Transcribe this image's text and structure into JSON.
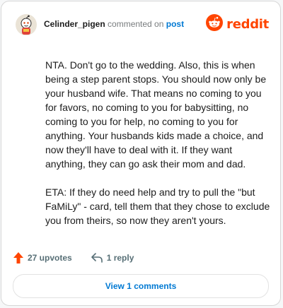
{
  "header": {
    "username": "Celinder_pigen",
    "action_text": "commented on",
    "post_link": "post",
    "brand_name": "reddit",
    "avatar_icon": "snoo-avatar-icon",
    "brand_icon": "reddit-logo-icon"
  },
  "comment": {
    "paragraphs": [
      "NTA. Don't go to the wedding. Also, this is when being a step parent stops. You should now only be your husband wife. That means no coming to you for favors, no coming to you for babysitting, no coming to you for help, no coming to you for anything. Your husbands kids made a choice, and now they'll have to deal with it. If they want anything, they can go ask their mom and dad.",
      "ETA: If they do need help and try to pull the \"but FaMiLy\" - card, tell them that they chose to exclude you from theirs, so now they aren't yours."
    ]
  },
  "actions": {
    "upvotes_label": "27 upvotes",
    "reply_label": "1 reply",
    "upvote_icon": "upvote-arrow-icon",
    "reply_icon": "reply-arrow-icon"
  },
  "footer": {
    "view_comments_label": "View 1 comments"
  },
  "colors": {
    "brand": "#ff4500",
    "link": "#0079d3",
    "text": "#1c1c1c",
    "muted": "#576f76"
  }
}
